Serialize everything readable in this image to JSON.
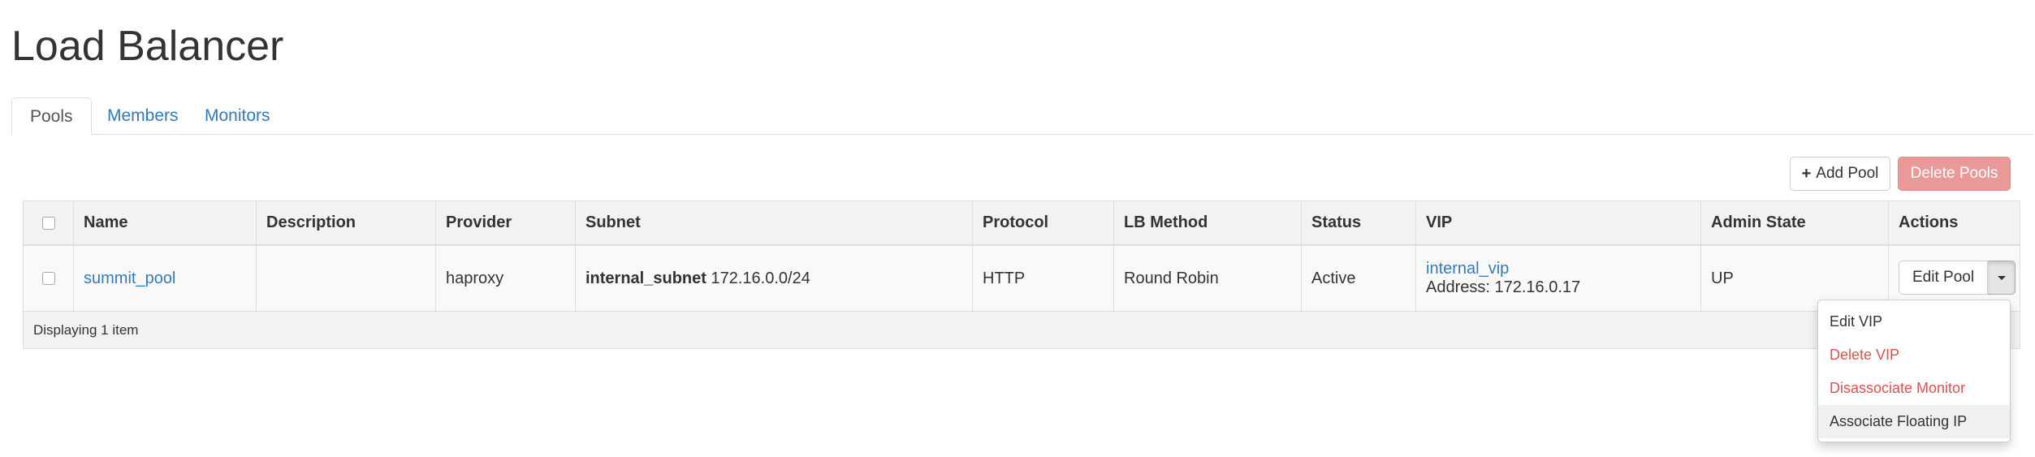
{
  "page": {
    "title": "Load Balancer"
  },
  "tabs": [
    {
      "label": "Pools",
      "active": true
    },
    {
      "label": "Members",
      "active": false
    },
    {
      "label": "Monitors",
      "active": false
    }
  ],
  "actions": {
    "add_pool": "Add Pool",
    "add_icon": "plus-icon",
    "delete_pools": "Delete Pools"
  },
  "table": {
    "columns": [
      "Name",
      "Description",
      "Provider",
      "Subnet",
      "Protocol",
      "LB Method",
      "Status",
      "VIP",
      "Admin State",
      "Actions"
    ],
    "rows": [
      {
        "name": "summit_pool",
        "description": "",
        "provider": "haproxy",
        "subnet_name": "internal_subnet",
        "subnet_cidr": "172.16.0.0/24",
        "protocol": "HTTP",
        "lb_method": "Round Robin",
        "status": "Active",
        "vip_name": "internal_vip",
        "vip_address": "Address: 172.16.0.17",
        "admin_state": "UP",
        "action_label": "Edit Pool"
      }
    ],
    "footer": "Displaying 1 item"
  },
  "dropdown": {
    "items": [
      {
        "label": "Edit VIP",
        "style": "normal"
      },
      {
        "label": "Delete VIP",
        "style": "danger"
      },
      {
        "label": "Disassociate Monitor",
        "style": "danger"
      },
      {
        "label": "Associate Floating IP",
        "style": "hover"
      }
    ]
  },
  "colors": {
    "link": "#337ab7",
    "danger": "#d9534f",
    "danger_disabled": "#e99a98"
  }
}
